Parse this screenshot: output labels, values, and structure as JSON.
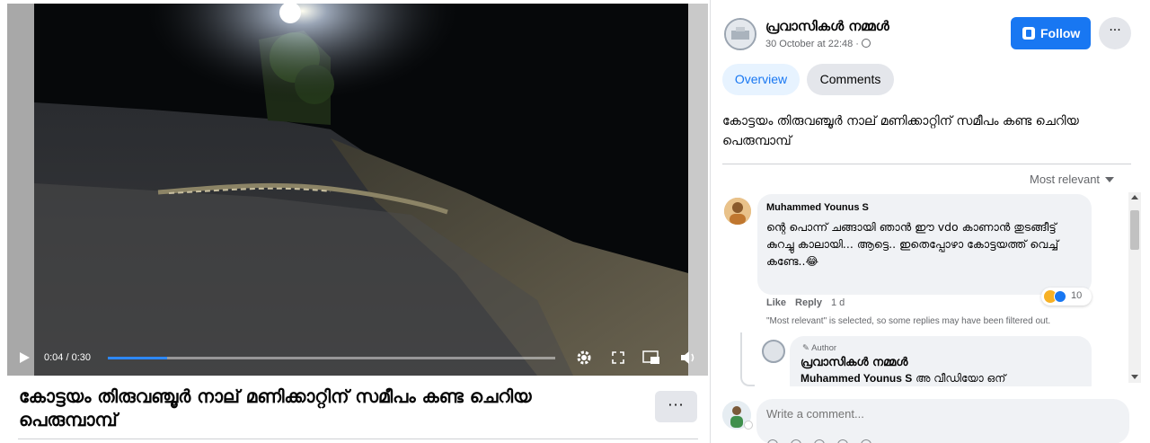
{
  "video": {
    "time": "0:04 / 0:30",
    "progress_fraction": 0.133,
    "title": "കോട്ടയം തിരുവഞ്ചൂർ നാല് മണിക്കാറ്റിന് സമീപം കണ്ട ചെറിയ പെരുമ്പാമ്പ്",
    "more_label": "···"
  },
  "post": {
    "page_name": "പ്രവാസികൾ നമ്മൾ",
    "timestamp": "30 October at 22:48 ·",
    "follow_label": "Follow",
    "more_label": "···",
    "caption": "കോട്ടയം തിരുവഞ്ചൂർ നാല് മണിക്കാറ്റിന് സമീപം കണ്ട ചെറിയ പെരുമ്പാമ്പ്"
  },
  "tabs": [
    {
      "label": "Overview",
      "active": true
    },
    {
      "label": "Comments",
      "active": false
    }
  ],
  "sort_label": "Most relevant",
  "comment": {
    "author": "Muhammed Younus S",
    "text": "ന്റെ പൊന്ന് ചങ്ങായി ഞാൻ ഈ vdo കാണാൻ തുടങ്ങീട്ട് കുറച്ചു കാലായി... ആട്ടെ.. ഇതെപ്പോഴാ കോട്ടയത്ത് വെച്ച് കണ്ടേ..😂",
    "like_label": "Like",
    "reply_label": "Reply",
    "age": "1 d",
    "reaction_count": "10",
    "filter_note": "\"Most relevant\" is selected, so some replies may have been filtered out."
  },
  "reply": {
    "badge": "Author",
    "author": "പ്രവാസികൾ നമ്മൾ",
    "mention": "Muhammed Younus S",
    "text": "അ വീഡിയോ ഒന്"
  },
  "composer": {
    "placeholder": "Write a comment..."
  },
  "colors": {
    "accent": "#1877f2",
    "bubble": "#f0f2f5",
    "muted_text": "#65676b"
  }
}
